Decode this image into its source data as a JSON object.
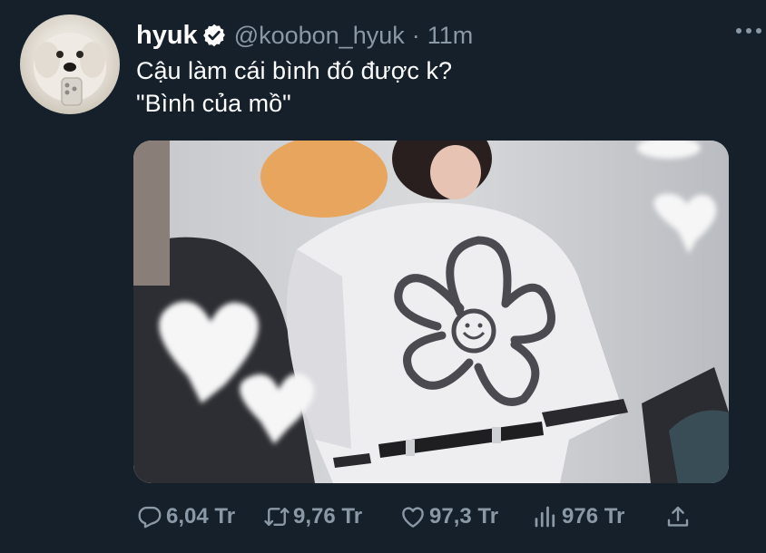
{
  "tweet": {
    "display_name": "hyuk",
    "handle": "@koobon_hyuk",
    "separator": "·",
    "time": "11m",
    "text_lines": [
      "Cậu làm cái bình đó được k?",
      "\"Bình của mồ\""
    ]
  },
  "actions": {
    "reply_count": "6,04 Tr",
    "retweet_count": "9,76 Tr",
    "like_count": "97,3 Tr",
    "view_count": "976 Tr"
  },
  "icons": {
    "verified": "verified-badge-icon",
    "more": "more-dots-icon",
    "reply": "reply-bubble-icon",
    "retweet": "retweet-arrows-icon",
    "like": "heart-icon",
    "views": "analytics-bars-icon",
    "share": "share-upload-icon"
  },
  "colors": {
    "background": "#15202b",
    "text_primary": "#ffffff",
    "text_secondary": "#8b98a5"
  }
}
